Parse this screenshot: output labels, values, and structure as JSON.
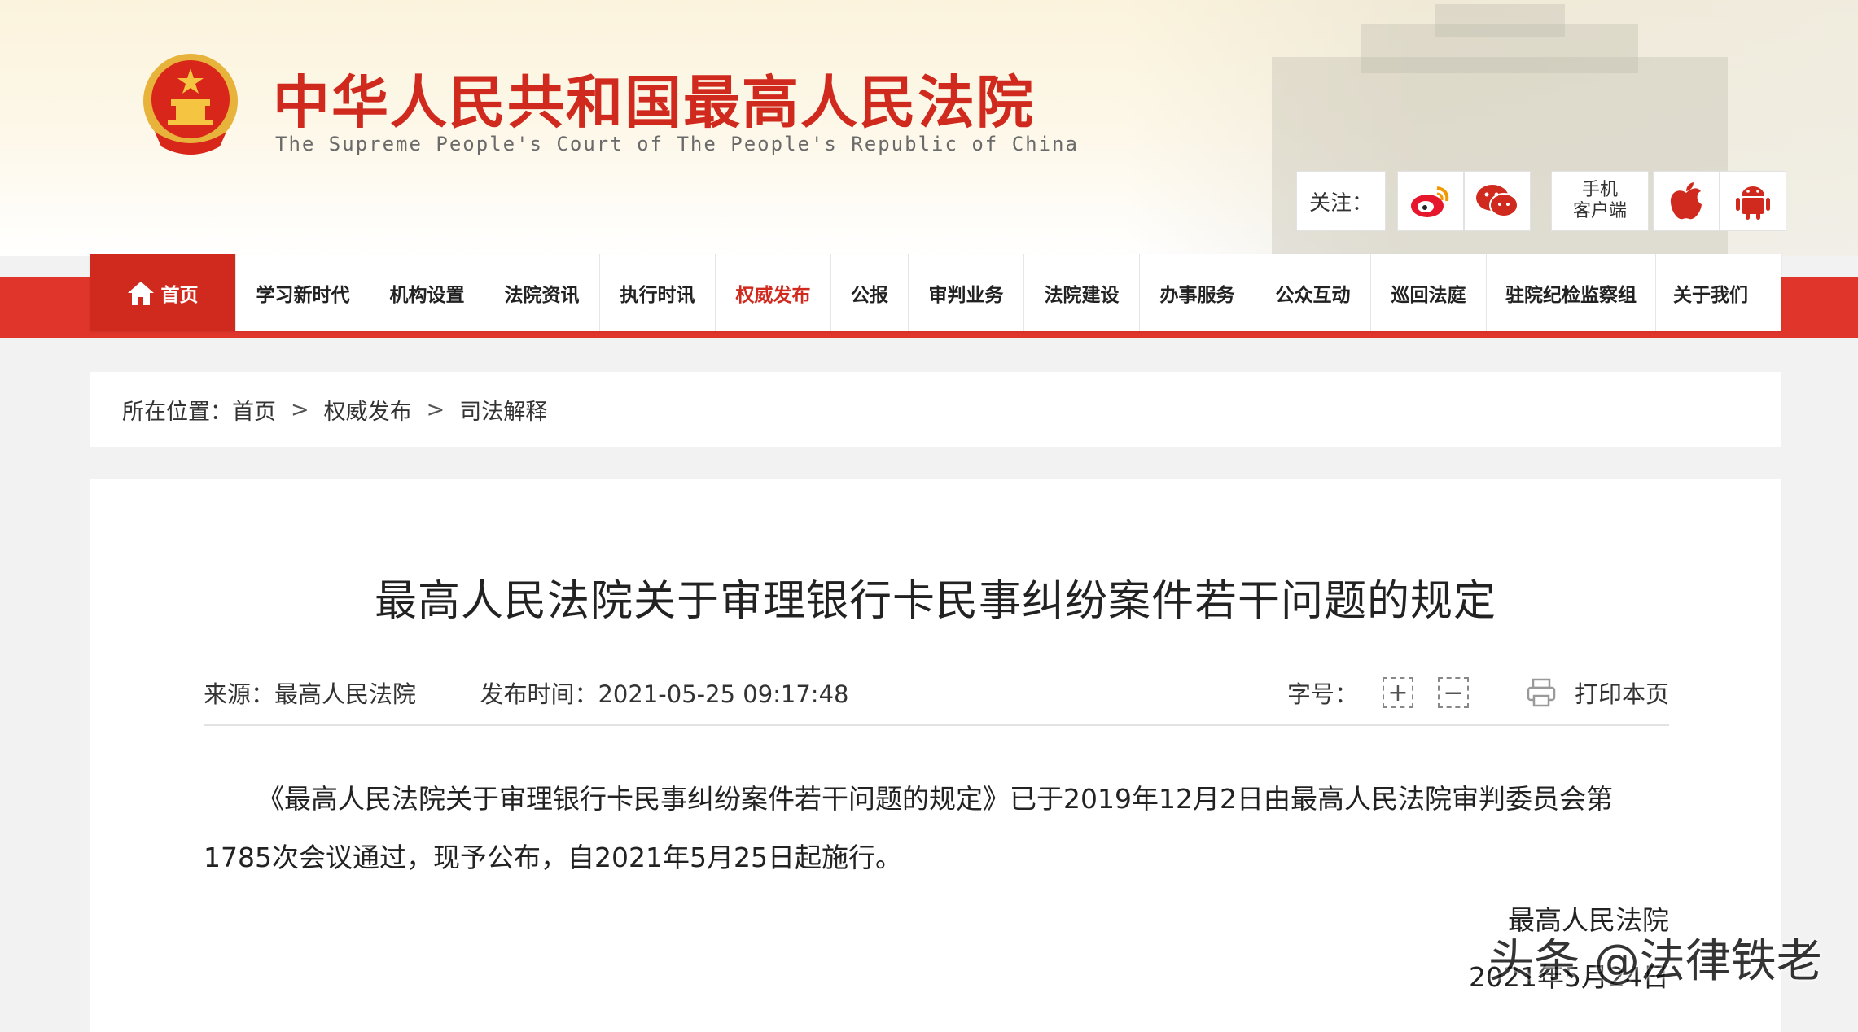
{
  "header": {
    "title": "中华人民共和国最高人民法院",
    "subtitle": "The Supreme People's Court of The People's Republic of China",
    "follow_label": "关注：",
    "social": [
      {
        "name": "weibo-icon",
        "color": "#e6162d"
      },
      {
        "name": "wechat-icon",
        "color": "#d02a1e"
      },
      {
        "name": "apple-icon",
        "color": "#d02a1e"
      },
      {
        "name": "android-icon",
        "color": "#d02a1e"
      }
    ],
    "mobile_line1": "手机",
    "mobile_line2": "客户端"
  },
  "nav": {
    "items": [
      {
        "label": "首页",
        "width": 180
      },
      {
        "label": "学习新时代",
        "width": 165
      },
      {
        "label": "机构设置",
        "width": 140
      },
      {
        "label": "法院资讯",
        "width": 142
      },
      {
        "label": "执行时讯",
        "width": 142
      },
      {
        "label": "权威发布",
        "width": 142
      },
      {
        "label": "公报",
        "width": 95
      },
      {
        "label": "审判业务",
        "width": 142
      },
      {
        "label": "法院建设",
        "width": 142
      },
      {
        "label": "办事服务",
        "width": 142
      },
      {
        "label": "公众互动",
        "width": 142
      },
      {
        "label": "巡回法庭",
        "width": 142
      },
      {
        "label": "驻院纪检监察组",
        "width": 208
      },
      {
        "label": "关于我们",
        "width": 134
      }
    ],
    "active": "权威发布"
  },
  "breadcrumb": {
    "prefix": "所在位置：",
    "items": [
      "首页",
      "权威发布",
      "司法解释"
    ],
    "separator": ">"
  },
  "article": {
    "title": "最高人民法院关于审理银行卡民事纠纷案件若干问题的规定",
    "source_label": "来源：",
    "source": "最高人民法院",
    "time_label": "发布时间：",
    "time": "2021-05-25 09:17:48",
    "fontsize_label": "字号：",
    "increase": "+",
    "decrease": "−",
    "print_label": "打印本页",
    "body": "《最高人民法院关于审理银行卡民事纠纷案件若干问题的规定》已于2019年12月2日由最高人民法院审判委员会第1785次会议通过，现予公布，自2021年5月25日起施行。",
    "sign_org": "最高人民法院",
    "sign_date": "2021年5月24日"
  },
  "watermark": "头条 @法律铁老"
}
